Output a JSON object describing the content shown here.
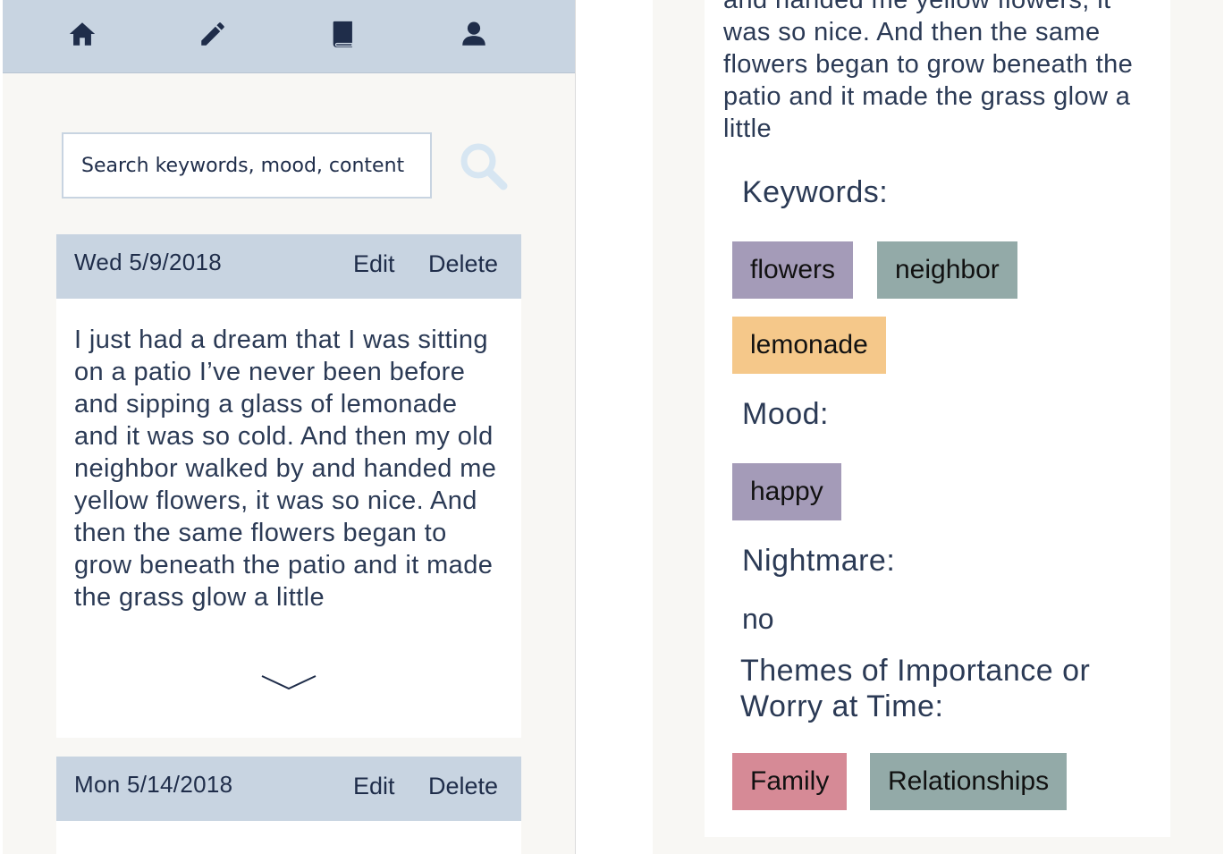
{
  "nav": {
    "items": [
      {
        "name": "home-icon"
      },
      {
        "name": "pencil-icon"
      },
      {
        "name": "journal-book-icon"
      },
      {
        "name": "user-icon"
      }
    ],
    "icon_color": "#1f2d4a",
    "bar_color": "#c8d4e1"
  },
  "search": {
    "placeholder": "Search keywords, mood, content",
    "icon": "search-icon",
    "icon_color": "#d7e6f2"
  },
  "entries": [
    {
      "date": "Wed 5/9/2018",
      "edit_label": "Edit",
      "delete_label": "Delete",
      "text": "I just had a dream that I was sitting on a patio I’ve never been before and sipping a glass of lemonade and it was so cold. And then my old neighbor walked by and handed me yellow flowers, it was so nice. And then the same flowers began to grow beneath the patio and it made the grass glow a little"
    },
    {
      "date": "Mon 5/14/2018",
      "edit_label": "Edit",
      "delete_label": "Delete"
    }
  ],
  "detail": {
    "text_tail": "and handed me yellow flowers, it was so nice. And then the same flowers began to grow beneath the patio and it made the grass glow a little",
    "keywords_title": "Keywords:",
    "keywords": [
      {
        "label": "flowers",
        "color": "#a49bb8"
      },
      {
        "label": "neighbor",
        "color": "#93aaa8"
      },
      {
        "label": "lemonade",
        "color": "#f5c88a"
      }
    ],
    "mood_title": "Mood:",
    "moods": [
      {
        "label": "happy",
        "color": "#a49bb8"
      }
    ],
    "nightmare_title": "Nightmare:",
    "nightmare_value": "no",
    "themes_title": "Themes of Importance or Worry at Time:",
    "themes": [
      {
        "label": "Family",
        "color": "#d68a96"
      },
      {
        "label": "Relationships",
        "color": "#93aaa8"
      }
    ]
  }
}
